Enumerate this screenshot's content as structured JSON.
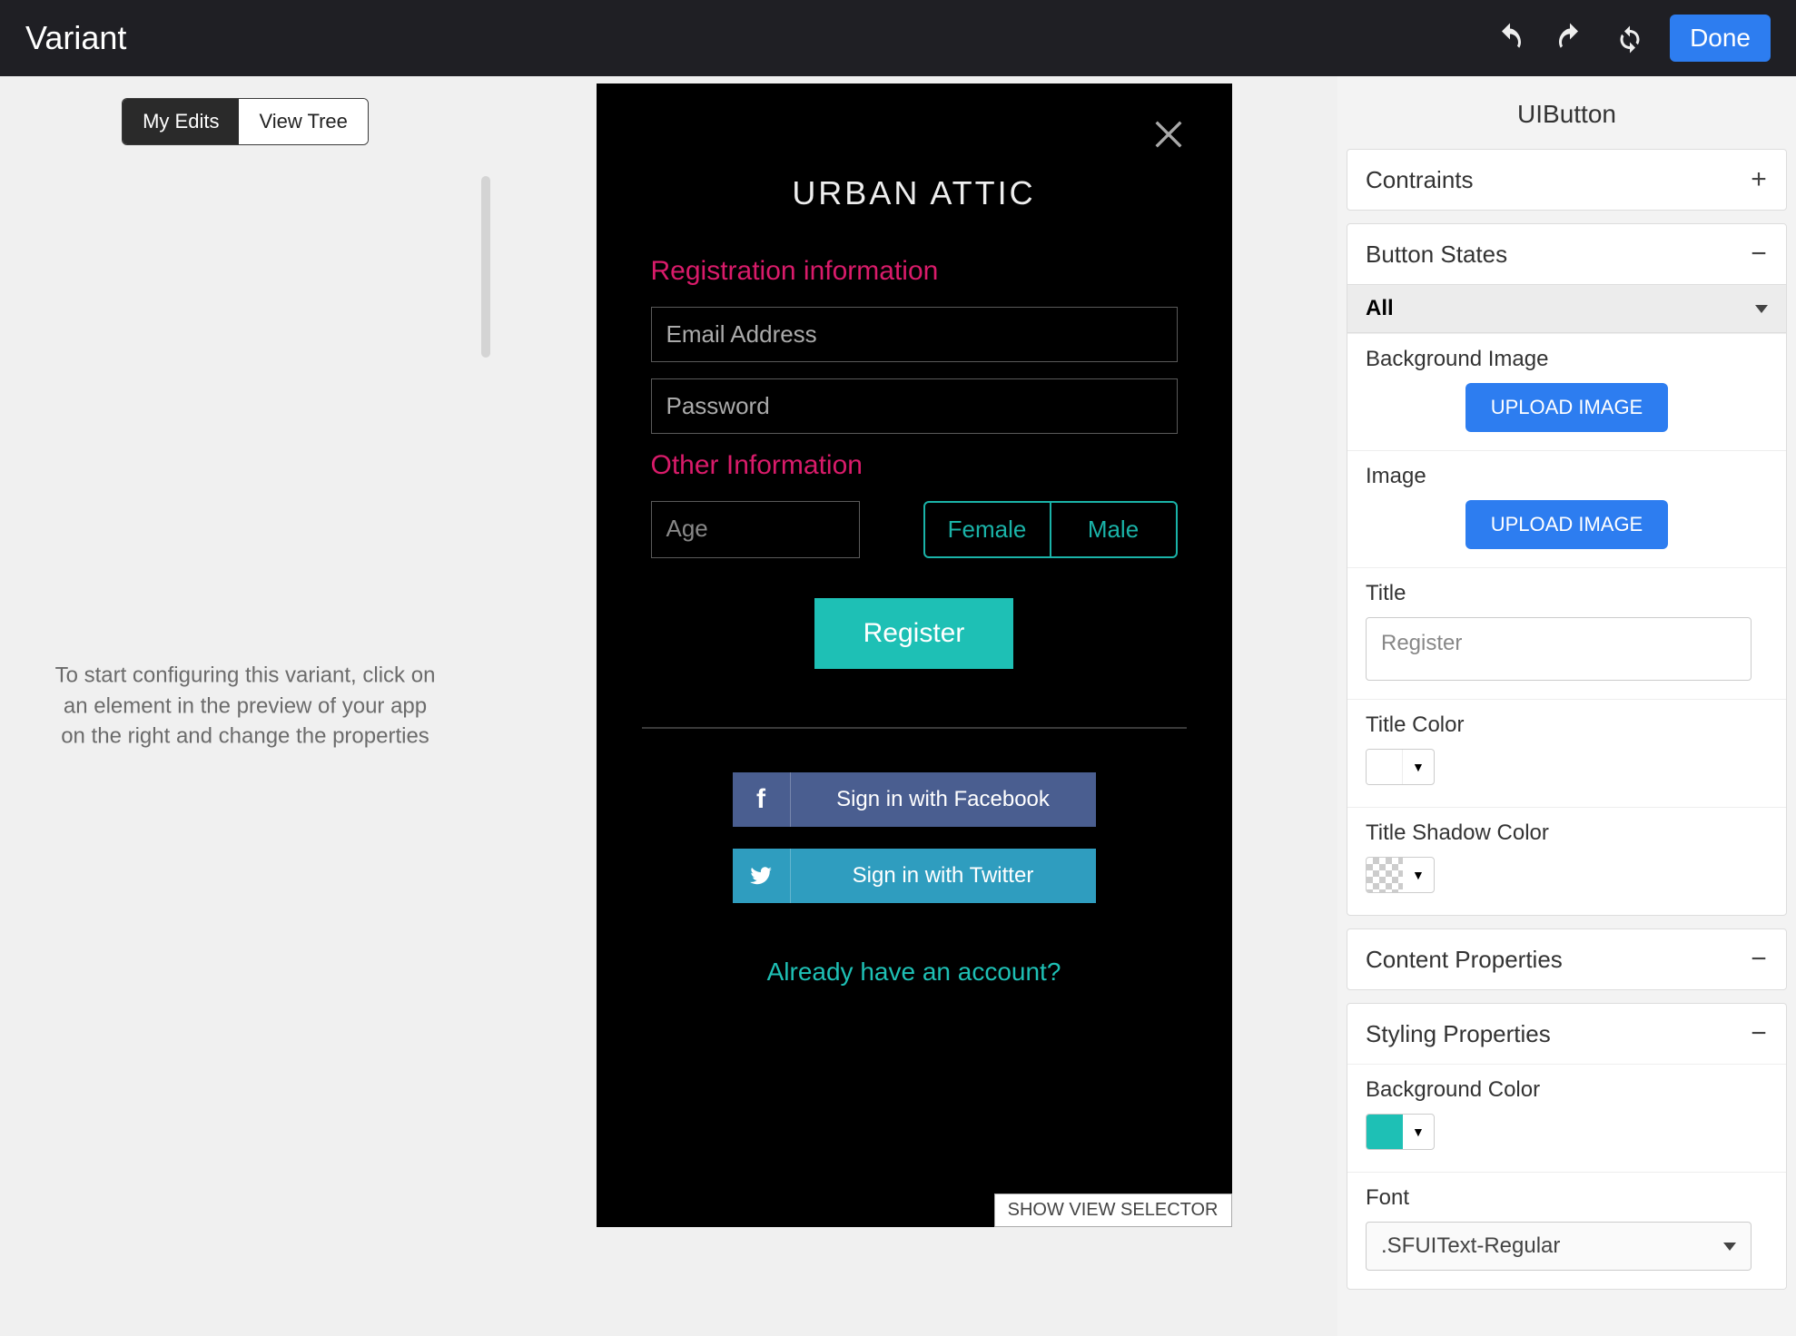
{
  "topbar": {
    "title": "Variant",
    "done_label": "Done"
  },
  "left": {
    "tab_myedits": "My Edits",
    "tab_viewtree": "View Tree",
    "help_text": "To start configuring this variant, click on an element in the preview of your app on the right and change the properties"
  },
  "preview": {
    "app_title": "URBAN ATTIC",
    "section_registration": "Registration information",
    "email_placeholder": "Email Address",
    "password_placeholder": "Password",
    "section_other": "Other Information",
    "age_placeholder": "Age",
    "gender_female": "Female",
    "gender_male": "Male",
    "register_label": "Register",
    "facebook_label": "Sign in with Facebook",
    "twitter_label": "Sign in with Twitter",
    "already_text": "Already have an account?",
    "show_selector": "SHOW VIEW SELECTOR"
  },
  "inspector": {
    "title": "UIButton",
    "sections": {
      "constraints": {
        "label": "Contraints",
        "expanded": false
      },
      "button_states": {
        "label": "Button States",
        "expanded": true,
        "state_options_selected": "All",
        "background_image_label": "Background Image",
        "image_label": "Image",
        "upload_label": "UPLOAD IMAGE",
        "title_label": "Title",
        "title_value": "Register",
        "title_color_label": "Title Color",
        "title_color_value": "#ffffff",
        "title_shadow_label": "Title Shadow Color",
        "title_shadow_value": "transparent"
      },
      "content_properties": {
        "label": "Content Properties",
        "expanded": true
      },
      "styling_properties": {
        "label": "Styling Properties",
        "expanded": true,
        "bg_color_label": "Background Color",
        "bg_color_value": "#1ec0b5",
        "font_label": "Font",
        "font_value": ".SFUIText-Regular"
      }
    }
  }
}
